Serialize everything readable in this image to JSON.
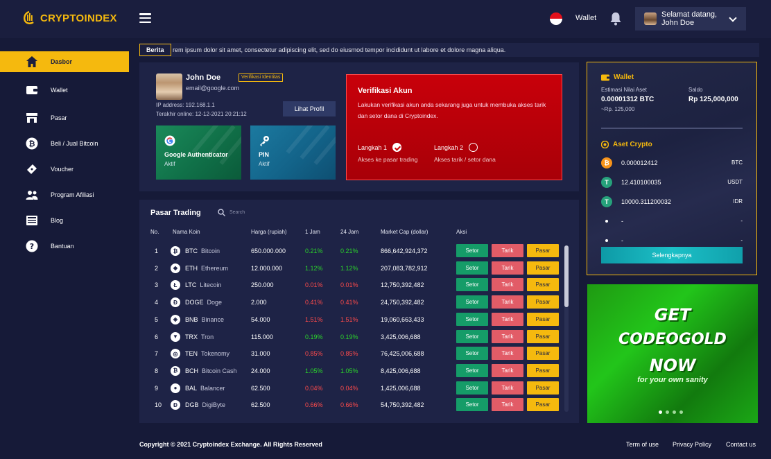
{
  "header": {
    "logo_text": "CRYPTOINDEX",
    "wallet_label": "Wallet",
    "greeting_line1": "Selamat datang,",
    "greeting_line2": "John Doe"
  },
  "sidebar": {
    "items": [
      {
        "label": "Dasbor",
        "icon": "home-icon",
        "active": true
      },
      {
        "label": "Wallet",
        "icon": "wallet-icon"
      },
      {
        "label": "Pasar",
        "icon": "store-icon"
      },
      {
        "label": "Beli / Jual Bitcoin",
        "icon": "bitcoin-icon"
      },
      {
        "label": "Voucher",
        "icon": "ticket-icon"
      },
      {
        "label": "Program Afiliasi",
        "icon": "users-icon"
      },
      {
        "label": "Blog",
        "icon": "newspaper-icon"
      },
      {
        "label": "Bantuan",
        "icon": "help-icon"
      }
    ]
  },
  "news": {
    "badge": "Berita",
    "text": "rem ipsum dolor sit amet, consectetur adipiscing elit, sed do eiusmod tempor incididunt ut labore et dolore magna aliqua."
  },
  "profile": {
    "name": "John Doe",
    "email": "email@google.com",
    "verify_badge": "Verifikasi Identitas",
    "ip": "IP address: 192.168.1.1",
    "last_online": "Terakhir online: 12-12-2021 20:21:12",
    "button": "Lihat Profil",
    "ga_title": "Google Authenticator",
    "ga_status": "Aktif",
    "pin_title": "PIN",
    "pin_status": "Aktif"
  },
  "verification": {
    "title": "Verifikasi Akun",
    "desc": "Lakukan verifikasi akun anda sekarang juga untuk membuka akses tarik dan setor dana di Cryptoindex.",
    "step1": "Langkah 1",
    "step1_sub": "Akses ke pasar trading",
    "step2": "Langkah 2",
    "step2_sub": "Akses tarik / setor dana"
  },
  "market": {
    "title": "Pasar Trading",
    "search_placeholder": "Search",
    "headers": [
      "No.",
      "Nama Koin",
      "Harga (rupiah)",
      "1 Jam",
      "24 Jam",
      "Market Cap (dollar)",
      "Aksi"
    ],
    "btn_setor": "Setor",
    "btn_tarik": "Tarik",
    "btn_pasar": "Pasar",
    "scroll_fraction": 0.37,
    "rows": [
      {
        "no": "1",
        "glyph": "₿",
        "sym": "BTC",
        "name": "Bitcoin",
        "price": "650.000.000",
        "h1": "0.21%",
        "h1_dir": "up",
        "h24": "0.21%",
        "h24_dir": "up",
        "cap": "866,642,924,372"
      },
      {
        "no": "2",
        "glyph": "◆",
        "sym": "ETH",
        "name": "Ethereum",
        "price": "12.000.000",
        "h1": "1.12%",
        "h1_dir": "up",
        "h24": "1.12%",
        "h24_dir": "up",
        "cap": "207,083,782,912"
      },
      {
        "no": "3",
        "glyph": "Ł",
        "sym": "LTC",
        "name": "Litecoin",
        "price": "250.000",
        "h1": "0.01%",
        "h1_dir": "down",
        "h24": "0.01%",
        "h24_dir": "down",
        "cap": "12,750,392,482"
      },
      {
        "no": "4",
        "glyph": "Ð",
        "sym": "DOGE",
        "name": "Doge",
        "price": "2.000",
        "h1": "0.41%",
        "h1_dir": "down",
        "h24": "0.41%",
        "h24_dir": "down",
        "cap": "24,750,392,482"
      },
      {
        "no": "5",
        "glyph": "◈",
        "sym": "BNB",
        "name": "Binance",
        "price": "54.000",
        "h1": "1.51%",
        "h1_dir": "down",
        "h24": "1.51%",
        "h24_dir": "down",
        "cap": "19,060,663,433"
      },
      {
        "no": "6",
        "glyph": "▼",
        "sym": "TRX",
        "name": "Tron",
        "price": "115.000",
        "h1": "0.19%",
        "h1_dir": "up",
        "h24": "0.19%",
        "h24_dir": "up",
        "cap": "3,425,006,688"
      },
      {
        "no": "7",
        "glyph": "◎",
        "sym": "TEN",
        "name": "Tokenomy",
        "price": "31.000",
        "h1": "0.85%",
        "h1_dir": "down",
        "h24": "0.85%",
        "h24_dir": "down",
        "cap": "76,425,006,688"
      },
      {
        "no": "8",
        "glyph": "₿",
        "sym": "BCH",
        "name": "Bitcoin Cash",
        "price": "24.000",
        "h1": "1.05%",
        "h1_dir": "up",
        "h24": "1.05%",
        "h24_dir": "up",
        "cap": "8,425,006,688"
      },
      {
        "no": "9",
        "glyph": "●",
        "sym": "BAL",
        "name": "Balancer",
        "price": "62.500",
        "h1": "0.04%",
        "h1_dir": "down",
        "h24": "0.04%",
        "h24_dir": "down",
        "cap": "1,425,006,688"
      },
      {
        "no": "10",
        "glyph": "Đ",
        "sym": "DGB",
        "name": "DigiByte",
        "price": "62.500",
        "h1": "0.66%",
        "h1_dir": "down",
        "h24": "0.66%",
        "h24_dir": "down",
        "cap": "54,750,392,482"
      }
    ]
  },
  "wallet": {
    "title": "Wallet",
    "est_label": "Estimasi Nilai Aset",
    "est_value": "0.00001312 BTC",
    "est_rp": "~Rp. 125,000",
    "saldo_label": "Saldo",
    "saldo_value": "Rp 125,000,000",
    "assets_title": "Aset Crypto",
    "assets": [
      {
        "amount": "0.000012412",
        "cur": "BTC",
        "glyph": "₿",
        "color": "#f7931a"
      },
      {
        "amount": "12.410100035",
        "cur": "USDT",
        "glyph": "T",
        "color": "#26a17b"
      },
      {
        "amount": "10000.311200032",
        "cur": "IDR",
        "glyph": "T",
        "color": "#26a17b"
      },
      {
        "amount": "-",
        "cur": "-",
        "glyph": "",
        "color": ""
      },
      {
        "amount": "-",
        "cur": "-",
        "glyph": "",
        "color": ""
      }
    ],
    "more_button": "Selengkapnya"
  },
  "promo": {
    "line1": "GET",
    "line2": "CODEOGOLD",
    "line3": "NOW",
    "sub": "for your own sanity"
  },
  "footer": {
    "copyright": "Copyright © 2021 Cryptoindex Exchange. All Rights Reserved",
    "terms": "Term of use",
    "privacy": "Privacy Policy",
    "contact": "Contact us"
  },
  "colors": {
    "accent": "#f5b90e",
    "bg": "#161a38",
    "panel": "#1e2346",
    "up": "#2bd42b",
    "down": "#ff4b4b"
  }
}
